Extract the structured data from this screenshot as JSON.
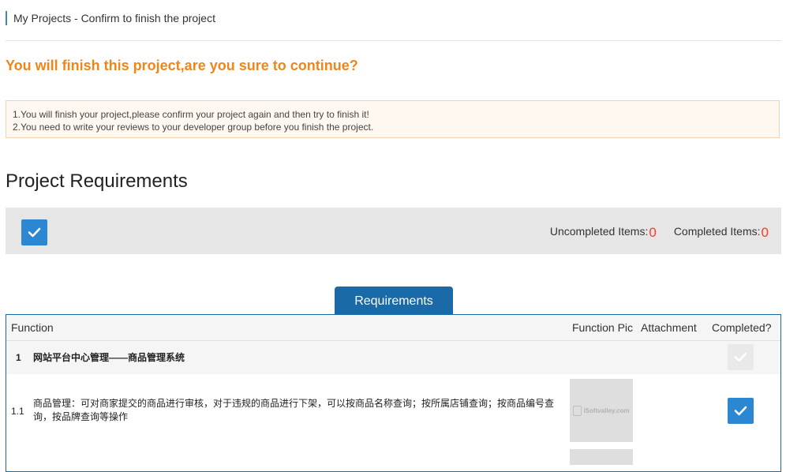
{
  "breadcrumb": {
    "text": "My Projects - Confirm to finish the project"
  },
  "confirm": {
    "title": "You will finish this project,are you sure to continue?"
  },
  "notice": {
    "line1": "1.You will finish your project,please confirm your project again and then try to finish it!",
    "line2": "2.You need to write your reviews to your developer group before you finish the project."
  },
  "requirements_section": {
    "title": "Project Requirements",
    "uncompleted_label": "Uncompleted Items:",
    "uncompleted_count": "0",
    "completed_label": "Completed Items:",
    "completed_count": "0"
  },
  "tabs": {
    "requirements": "Requirements"
  },
  "table": {
    "headers": {
      "function": "Function",
      "function_pic": "Function Pic",
      "attachment": "Attachment",
      "completed": "Completed?"
    },
    "rows": [
      {
        "index": "1",
        "function": "网站平台中心管理——商品管理系统",
        "completed": false
      },
      {
        "index": "1.1",
        "function": "商品管理：可对商家提交的商品进行审核，对于违规的商品进行下架，可以按商品名称查询；按所属店铺查询；按商品编号查询，按品牌查询等操作",
        "pic_watermark": "iSoftvalley.com",
        "completed": true
      }
    ]
  },
  "colors": {
    "accent": "#f08519",
    "primary": "#2b87d1",
    "tab": "#1a6aa8",
    "count": "#ff3b1f"
  }
}
